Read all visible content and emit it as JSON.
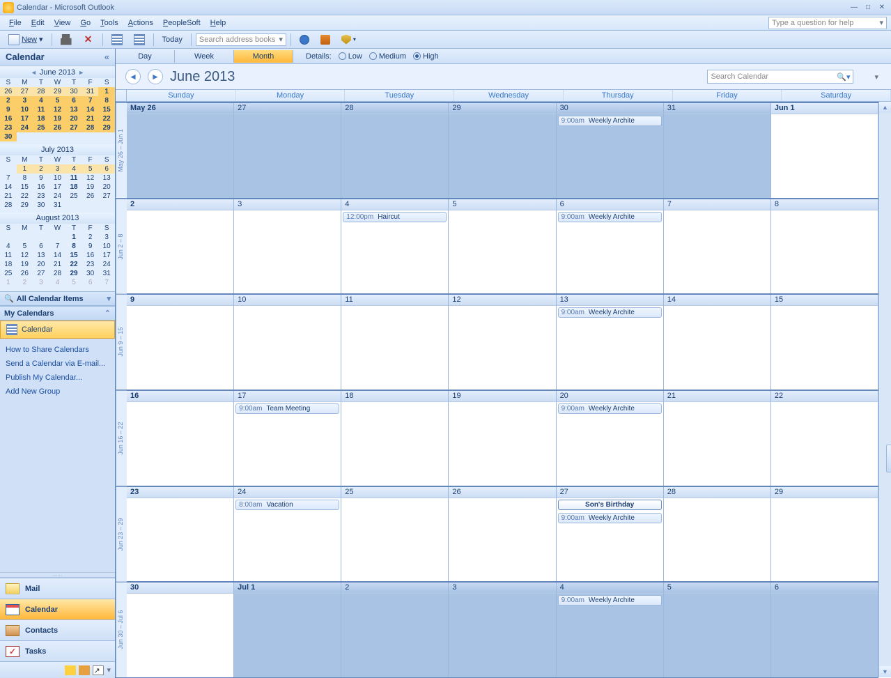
{
  "title": "Calendar - Microsoft Outlook",
  "menu": [
    "File",
    "Edit",
    "View",
    "Go",
    "Tools",
    "Actions",
    "PeopleSoft",
    "Help"
  ],
  "helpbox_placeholder": "Type a question for help",
  "toolbar": {
    "new_label": "New",
    "today_label": "Today",
    "addrbook_placeholder": "Search address books"
  },
  "nav": {
    "header": "Calendar",
    "all_items": "All Calendar Items",
    "my_calendars": "My Calendars",
    "calendar_item": "Calendar",
    "links": [
      "How to Share Calendars",
      "Send a Calendar via E-mail...",
      "Publish My Calendar...",
      "Add New Group"
    ],
    "big_buttons": [
      "Mail",
      "Calendar",
      "Contacts",
      "Tasks"
    ]
  },
  "minicals": [
    {
      "title": "June 2013",
      "nav": true,
      "dow": [
        "S",
        "M",
        "T",
        "W",
        "T",
        "F",
        "S"
      ],
      "rows": [
        [
          {
            "d": "26",
            "c": "hl2"
          },
          {
            "d": "27",
            "c": "hl2"
          },
          {
            "d": "28",
            "c": "hl2"
          },
          {
            "d": "29",
            "c": "hl2"
          },
          {
            "d": "30",
            "c": "hl2"
          },
          {
            "d": "31",
            "c": "hl2"
          },
          {
            "d": "1",
            "c": "hl"
          }
        ],
        [
          {
            "d": "2",
            "c": "hl"
          },
          {
            "d": "3",
            "c": "hl"
          },
          {
            "d": "4",
            "c": "hl"
          },
          {
            "d": "5",
            "c": "hl"
          },
          {
            "d": "6",
            "c": "hl"
          },
          {
            "d": "7",
            "c": "hl"
          },
          {
            "d": "8",
            "c": "hl"
          }
        ],
        [
          {
            "d": "9",
            "c": "hl"
          },
          {
            "d": "10",
            "c": "hl"
          },
          {
            "d": "11",
            "c": "hl"
          },
          {
            "d": "12",
            "c": "hl"
          },
          {
            "d": "13",
            "c": "hl"
          },
          {
            "d": "14",
            "c": "hl"
          },
          {
            "d": "15",
            "c": "hl"
          }
        ],
        [
          {
            "d": "16",
            "c": "hl"
          },
          {
            "d": "17",
            "c": "hl"
          },
          {
            "d": "18",
            "c": "hl"
          },
          {
            "d": "19",
            "c": "hl"
          },
          {
            "d": "20",
            "c": "hl"
          },
          {
            "d": "21",
            "c": "hl"
          },
          {
            "d": "22",
            "c": "hl"
          }
        ],
        [
          {
            "d": "23",
            "c": "hl"
          },
          {
            "d": "24",
            "c": "hl"
          },
          {
            "d": "25",
            "c": "hl"
          },
          {
            "d": "26",
            "c": "hl"
          },
          {
            "d": "27",
            "c": "hl"
          },
          {
            "d": "28",
            "c": "hl"
          },
          {
            "d": "29",
            "c": "hl"
          }
        ],
        [
          {
            "d": "30",
            "c": "hl"
          },
          {
            "d": ""
          },
          {
            "d": ""
          },
          {
            "d": ""
          },
          {
            "d": ""
          },
          {
            "d": ""
          },
          {
            "d": ""
          }
        ]
      ]
    },
    {
      "title": "July 2013",
      "nav": false,
      "dow": [
        "S",
        "M",
        "T",
        "W",
        "T",
        "F",
        "S"
      ],
      "rows": [
        [
          {
            "d": ""
          },
          {
            "d": "1",
            "c": "hl2"
          },
          {
            "d": "2",
            "c": "hl2"
          },
          {
            "d": "3",
            "c": "hl2"
          },
          {
            "d": "4",
            "c": "hl2"
          },
          {
            "d": "5",
            "c": "hl2"
          },
          {
            "d": "6",
            "c": "hl2"
          }
        ],
        [
          {
            "d": "7"
          },
          {
            "d": "8"
          },
          {
            "d": "9"
          },
          {
            "d": "10"
          },
          {
            "d": "11",
            "c": "bold"
          },
          {
            "d": "12"
          },
          {
            "d": "13"
          }
        ],
        [
          {
            "d": "14"
          },
          {
            "d": "15"
          },
          {
            "d": "16"
          },
          {
            "d": "17"
          },
          {
            "d": "18",
            "c": "bold"
          },
          {
            "d": "19"
          },
          {
            "d": "20"
          }
        ],
        [
          {
            "d": "21"
          },
          {
            "d": "22"
          },
          {
            "d": "23"
          },
          {
            "d": "24"
          },
          {
            "d": "25"
          },
          {
            "d": "26"
          },
          {
            "d": "27"
          }
        ],
        [
          {
            "d": "28"
          },
          {
            "d": "29"
          },
          {
            "d": "30"
          },
          {
            "d": "31"
          },
          {
            "d": ""
          },
          {
            "d": ""
          },
          {
            "d": ""
          }
        ]
      ]
    },
    {
      "title": "August 2013",
      "nav": false,
      "dow": [
        "S",
        "M",
        "T",
        "W",
        "T",
        "F",
        "S"
      ],
      "rows": [
        [
          {
            "d": ""
          },
          {
            "d": ""
          },
          {
            "d": ""
          },
          {
            "d": ""
          },
          {
            "d": "1",
            "c": "bold"
          },
          {
            "d": "2"
          },
          {
            "d": "3"
          }
        ],
        [
          {
            "d": "4"
          },
          {
            "d": "5"
          },
          {
            "d": "6"
          },
          {
            "d": "7"
          },
          {
            "d": "8",
            "c": "bold"
          },
          {
            "d": "9"
          },
          {
            "d": "10"
          }
        ],
        [
          {
            "d": "11"
          },
          {
            "d": "12"
          },
          {
            "d": "13"
          },
          {
            "d": "14"
          },
          {
            "d": "15",
            "c": "bold"
          },
          {
            "d": "16"
          },
          {
            "d": "17"
          }
        ],
        [
          {
            "d": "18"
          },
          {
            "d": "19"
          },
          {
            "d": "20"
          },
          {
            "d": "21"
          },
          {
            "d": "22",
            "c": "bold"
          },
          {
            "d": "23"
          },
          {
            "d": "24"
          }
        ],
        [
          {
            "d": "25"
          },
          {
            "d": "26"
          },
          {
            "d": "27"
          },
          {
            "d": "28"
          },
          {
            "d": "29",
            "c": "bold"
          },
          {
            "d": "30"
          },
          {
            "d": "31"
          }
        ],
        [
          {
            "d": "1",
            "c": "off"
          },
          {
            "d": "2",
            "c": "off"
          },
          {
            "d": "3",
            "c": "off"
          },
          {
            "d": "4",
            "c": "off"
          },
          {
            "d": "5",
            "c": "off"
          },
          {
            "d": "6",
            "c": "off"
          },
          {
            "d": "7",
            "c": "off"
          }
        ]
      ]
    }
  ],
  "view": {
    "tabs": [
      "Day",
      "Week",
      "Month"
    ],
    "selected": "Month",
    "details_label": "Details:",
    "details_opts": [
      "Low",
      "Medium",
      "High"
    ],
    "details_selected": "High",
    "title": "June 2013",
    "search_placeholder": "Search Calendar",
    "dow": [
      "Sunday",
      "Monday",
      "Tuesday",
      "Wednesday",
      "Thursday",
      "Friday",
      "Saturday"
    ]
  },
  "weeks": [
    {
      "gutter": "May 26 – Jun 1",
      "days": [
        {
          "hdr": "May 26",
          "off": true,
          "bold": true
        },
        {
          "hdr": "27",
          "off": true
        },
        {
          "hdr": "28",
          "off": true
        },
        {
          "hdr": "29",
          "off": true
        },
        {
          "hdr": "30",
          "off": true,
          "events": [
            {
              "t": "9:00am",
              "s": "Weekly Archite"
            }
          ]
        },
        {
          "hdr": "31",
          "off": true
        },
        {
          "hdr": "Jun 1",
          "bold": true
        }
      ]
    },
    {
      "gutter": "Jun 2 – 8",
      "days": [
        {
          "hdr": "2",
          "bold": true
        },
        {
          "hdr": "3"
        },
        {
          "hdr": "4",
          "events": [
            {
              "t": "12:00pm",
              "s": "Haircut"
            }
          ]
        },
        {
          "hdr": "5"
        },
        {
          "hdr": "6",
          "events": [
            {
              "t": "9:00am",
              "s": "Weekly Archite"
            }
          ]
        },
        {
          "hdr": "7"
        },
        {
          "hdr": "8"
        }
      ]
    },
    {
      "gutter": "Jun 9 – 15",
      "days": [
        {
          "hdr": "9",
          "bold": true
        },
        {
          "hdr": "10"
        },
        {
          "hdr": "11"
        },
        {
          "hdr": "12"
        },
        {
          "hdr": "13",
          "events": [
            {
              "t": "9:00am",
              "s": "Weekly Archite"
            }
          ]
        },
        {
          "hdr": "14"
        },
        {
          "hdr": "15"
        }
      ]
    },
    {
      "gutter": "Jun 16 – 22",
      "days": [
        {
          "hdr": "16",
          "bold": true
        },
        {
          "hdr": "17",
          "events": [
            {
              "t": "9:00am",
              "s": "Team Meeting"
            }
          ]
        },
        {
          "hdr": "18"
        },
        {
          "hdr": "19"
        },
        {
          "hdr": "20",
          "events": [
            {
              "t": "9:00am",
              "s": "Weekly Archite"
            }
          ]
        },
        {
          "hdr": "21"
        },
        {
          "hdr": "22"
        }
      ]
    },
    {
      "gutter": "Jun 23 – 29",
      "days": [
        {
          "hdr": "23",
          "bold": true
        },
        {
          "hdr": "24",
          "events": [
            {
              "t": "8:00am",
              "s": "Vacation"
            }
          ]
        },
        {
          "hdr": "25"
        },
        {
          "hdr": "26"
        },
        {
          "hdr": "27",
          "events": [
            {
              "allday": true,
              "s": "Son's Birthday"
            },
            {
              "t": "9:00am",
              "s": "Weekly Archite"
            }
          ]
        },
        {
          "hdr": "28"
        },
        {
          "hdr": "29"
        }
      ]
    },
    {
      "gutter": "Jun 30 – Jul 6",
      "days": [
        {
          "hdr": "30",
          "bold": true
        },
        {
          "hdr": "Jul 1",
          "off": true,
          "bold": true
        },
        {
          "hdr": "2",
          "off": true
        },
        {
          "hdr": "3",
          "off": true
        },
        {
          "hdr": "4",
          "off": true,
          "events": [
            {
              "t": "9:00am",
              "s": "Weekly Archite"
            }
          ]
        },
        {
          "hdr": "5",
          "off": true
        },
        {
          "hdr": "6",
          "off": true
        }
      ]
    }
  ]
}
